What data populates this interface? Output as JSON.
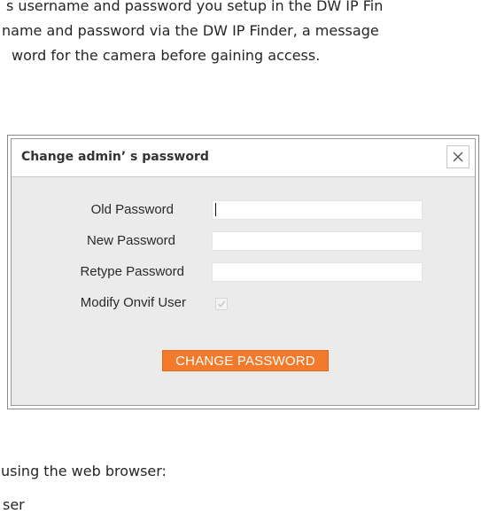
{
  "document": {
    "line1": "s username and password you setup in the DW IP Fin",
    "line2": "name and password via the DW IP Finder, a message",
    "line3": "word for the camera before gaining access.",
    "line4": "using the web browser:",
    "line5": "ser"
  },
  "dialog": {
    "title": "Change admin’ s password",
    "close_icon": "close-icon",
    "fields": [
      {
        "label": "Old Password",
        "value": ""
      },
      {
        "label": "New Password",
        "value": ""
      },
      {
        "label": "Retype Password",
        "value": ""
      }
    ],
    "checkbox": {
      "label": "Modify Onvif User",
      "checked": true
    },
    "submit_label": "CHANGE PASSWORD"
  },
  "colors": {
    "accent": "#f37a2a",
    "dialog_body": "#ebebeb"
  }
}
